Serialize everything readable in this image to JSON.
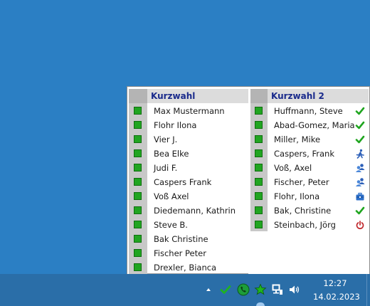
{
  "menu_left": {
    "title": "Kurzwahl",
    "items": [
      {
        "label": "Max Mustermann"
      },
      {
        "label": "Flohr Ilona"
      },
      {
        "label": "Vier J."
      },
      {
        "label": "Bea Elke"
      },
      {
        "label": "Judi F."
      },
      {
        "label": "Caspers Frank"
      },
      {
        "label": "Voß Axel"
      },
      {
        "label": "Diedemann, Kathrin"
      },
      {
        "label": "Steve B."
      },
      {
        "label": "Bak Christine"
      },
      {
        "label": "Fischer Peter"
      },
      {
        "label": "Drexler, Bianca"
      }
    ]
  },
  "menu_right": {
    "title": "Kurzwahl 2",
    "items": [
      {
        "label": "Huffmann, Steve",
        "status": "available-check-icon"
      },
      {
        "label": "Abad-Gomez, Maria",
        "status": "available-check-icon"
      },
      {
        "label": "Miller, Mike",
        "status": "available-check-icon"
      },
      {
        "label": "Caspers, Frank",
        "status": "away-running-icon"
      },
      {
        "label": "Voß, Axel",
        "status": "in-meeting-people-icon"
      },
      {
        "label": "Fischer, Peter",
        "status": "in-meeting-people-icon"
      },
      {
        "label": "Flohr, Ilona",
        "status": "business-briefcase-icon"
      },
      {
        "label": "Bak, Christine",
        "status": "available-check-icon"
      },
      {
        "label": "Steinbach, Jörg",
        "status": "offline-power-icon"
      }
    ]
  },
  "colors": {
    "header_text": "#1a2b8c",
    "presence_green": "#21a521",
    "desktop": "#2b7fc4",
    "taskbar": "#2a6ea8"
  },
  "taskbar": {
    "clock_time": "12:27",
    "clock_date": "14.02.2023",
    "tray_icons": [
      "show-hidden-icons-chevron",
      "presence-check-icon",
      "phone-app-icon",
      "favorites-star-icon",
      "network-icon",
      "volume-icon"
    ]
  }
}
